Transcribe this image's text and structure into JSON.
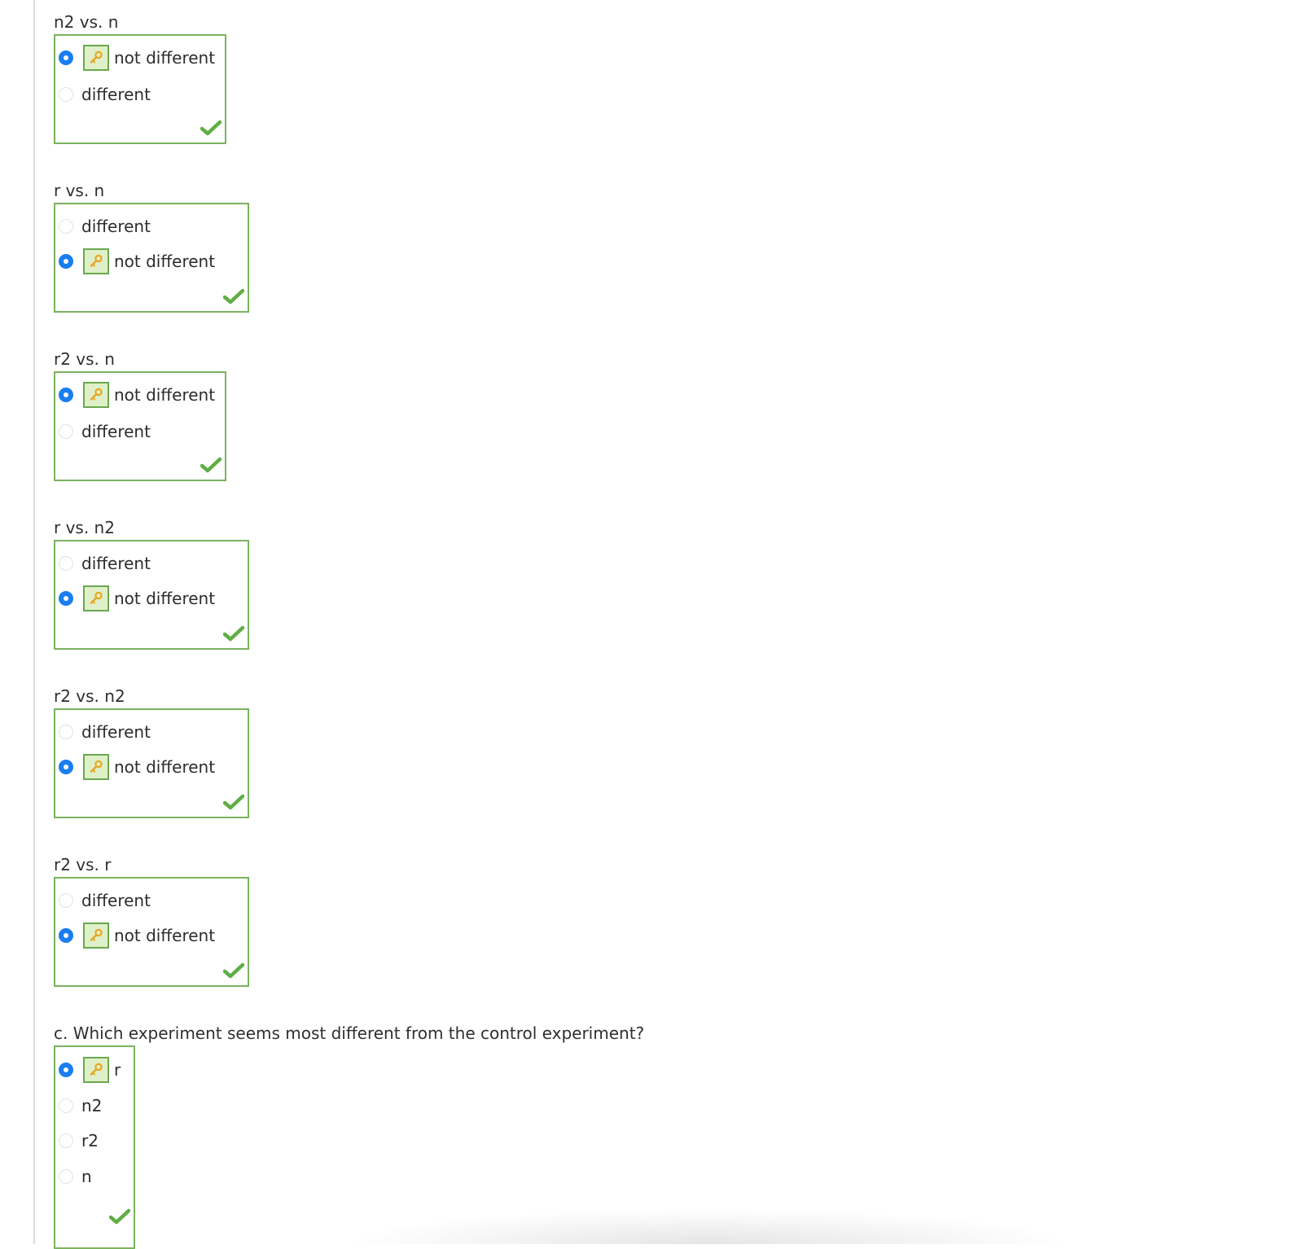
{
  "questions": [
    {
      "label": "n2 vs. n",
      "options": [
        {
          "text": "not different",
          "selected": true,
          "key": true
        },
        {
          "text": "different",
          "selected": false,
          "key": false
        }
      ],
      "correct": true
    },
    {
      "label": "r vs. n",
      "options": [
        {
          "text": "different",
          "selected": false,
          "key": false
        },
        {
          "text": "not different",
          "selected": true,
          "key": true
        }
      ],
      "correct": true
    },
    {
      "label": "r2 vs. n",
      "options": [
        {
          "text": "not different",
          "selected": true,
          "key": true
        },
        {
          "text": "different",
          "selected": false,
          "key": false
        }
      ],
      "correct": true
    },
    {
      "label": "r vs. n2",
      "options": [
        {
          "text": "different",
          "selected": false,
          "key": false
        },
        {
          "text": "not different",
          "selected": true,
          "key": true
        }
      ],
      "correct": true
    },
    {
      "label": "r2 vs. n2",
      "options": [
        {
          "text": "different",
          "selected": false,
          "key": false
        },
        {
          "text": "not different",
          "selected": true,
          "key": true
        }
      ],
      "correct": true
    },
    {
      "label": "r2 vs. r",
      "options": [
        {
          "text": "different",
          "selected": false,
          "key": false
        },
        {
          "text": "not different",
          "selected": true,
          "key": true
        }
      ],
      "correct": true
    },
    {
      "label": "c. Which experiment seems most different from the control experiment?",
      "options": [
        {
          "text": "r",
          "selected": true,
          "key": true
        },
        {
          "text": "n2",
          "selected": false,
          "key": false
        },
        {
          "text": "r2",
          "selected": false,
          "key": false
        },
        {
          "text": "n",
          "selected": false,
          "key": false
        }
      ],
      "correct": true
    }
  ],
  "colors": {
    "radio_selected": "#1a7ef0",
    "box_border": "#7bb25f",
    "key_badge_bg": "#dff0c9",
    "key_icon": "#e7a823",
    "checkmark": "#5fae45"
  },
  "icons": {
    "answer_key": "key-icon",
    "correct_mark": "checkmark-icon"
  }
}
